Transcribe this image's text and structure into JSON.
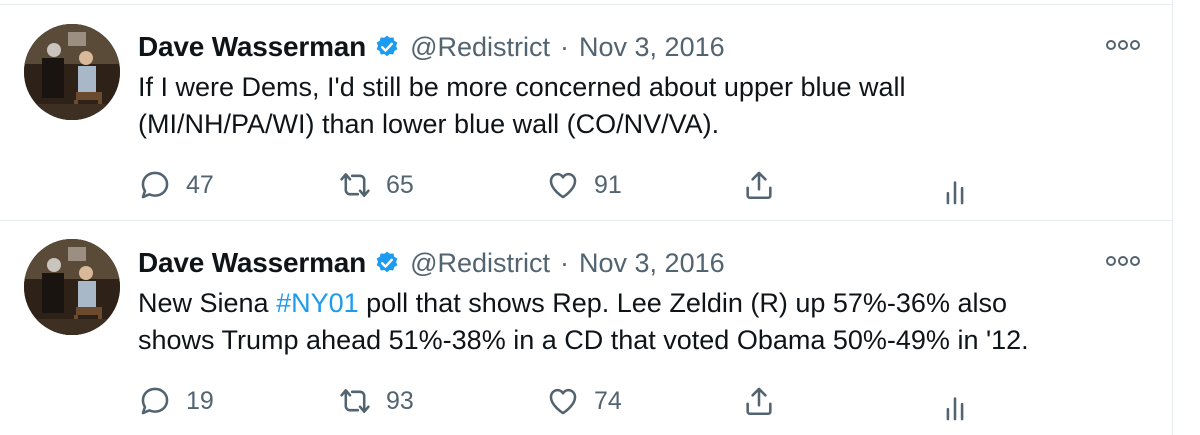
{
  "tweets": [
    {
      "author_name": "Dave Wasserman",
      "handle": "@Redistrict",
      "separator": "·",
      "date": "Nov 3, 2016",
      "text_line1": "If I were Dems, I'd still be more concerned about upper blue wall",
      "text_line2": "(MI/NH/PA/WI) than lower blue wall (CO/NV/VA).",
      "reply_count": "47",
      "retweet_count": "65",
      "like_count": "91"
    },
    {
      "author_name": "Dave Wasserman",
      "handle": "@Redistrict",
      "separator": "·",
      "date": "Nov 3, 2016",
      "text_prefix": "New Siena ",
      "hashtag": "#NY01",
      "text_suffix": " poll that shows Rep. Lee Zeldin (R) up 57%-36% also",
      "text_line2": "shows Trump ahead 51%-38% in a CD that voted Obama 50%-49% in '12.",
      "reply_count": "19",
      "retweet_count": "93",
      "like_count": "74"
    }
  ],
  "icons": {
    "verified": "verified-badge-icon",
    "more": "more-options-icon",
    "reply": "reply-icon",
    "retweet": "retweet-icon",
    "like": "heart-icon",
    "share": "share-icon",
    "analytics": "analytics-icon"
  },
  "colors": {
    "accent": "#1d9bf0",
    "secondary_text": "#536471",
    "border": "#e6ecf0"
  }
}
